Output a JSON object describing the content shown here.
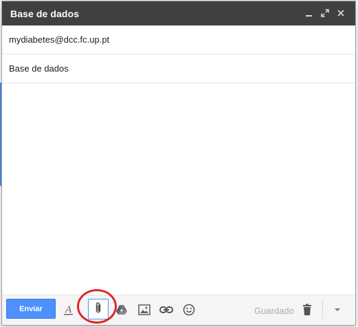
{
  "window": {
    "title": "Base de dados",
    "controls": {
      "minimize_icon": "minimize-icon",
      "popout_icon": "popout-icon",
      "close_icon": "close-icon"
    }
  },
  "fields": {
    "to_value": "mydiabetes@dcc.fc.up.pt",
    "subject_value": "Base de dados"
  },
  "toolbar": {
    "send_label": "Enviar",
    "status": "Guardado",
    "icons": [
      "formatting-icon",
      "attach-file-icon",
      "google-drive-icon",
      "insert-photo-icon",
      "insert-link-icon",
      "emoji-icon",
      "discard-icon",
      "more-options-icon"
    ]
  },
  "colors": {
    "titlebar": "#404040",
    "send_button": "#4d90fe",
    "highlight_circle": "#e0262a"
  }
}
